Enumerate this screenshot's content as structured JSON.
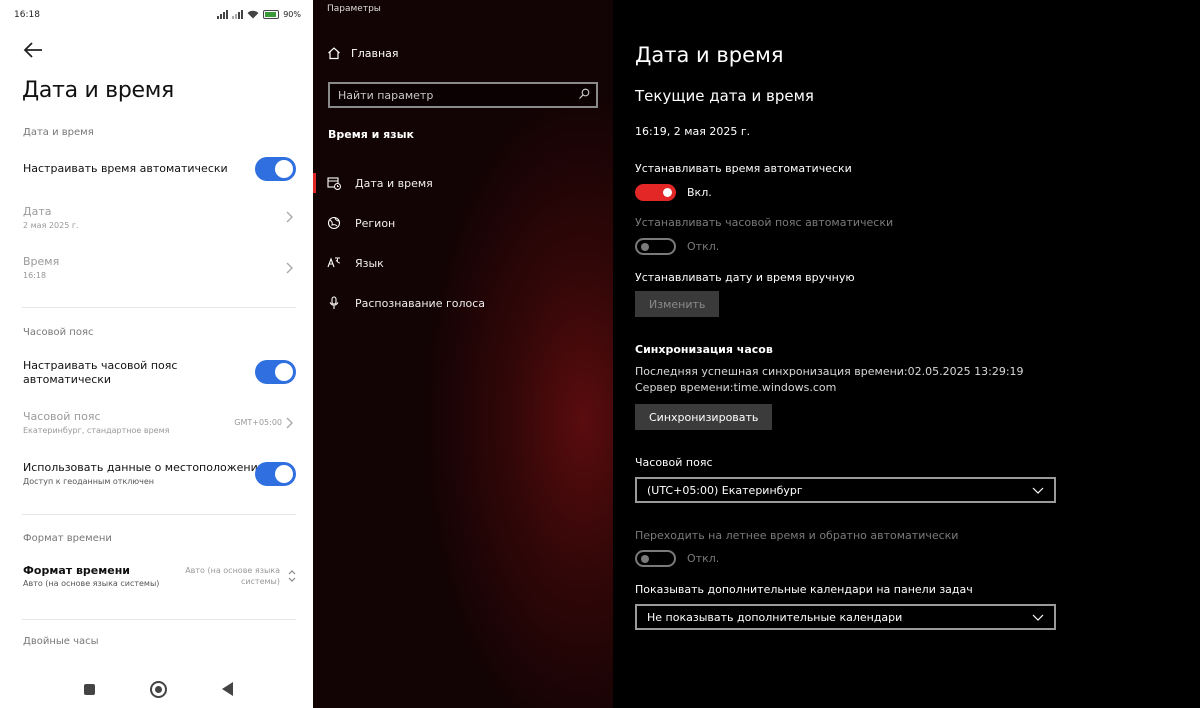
{
  "android": {
    "status": {
      "time": "16:18",
      "battery": "90%"
    },
    "title": "Дата и время",
    "section_datetime": "Дата и время",
    "auto_time_label": "Настраивать время автоматически",
    "date_label": "Дата",
    "date_value": "2 мая 2025 г.",
    "time_label": "Время",
    "time_value": "16:18",
    "section_timezone": "Часовой пояс",
    "auto_tz_line1": "Настраивать часовой пояс",
    "auto_tz_line2": "автоматически",
    "tz_label": "Часовой пояс",
    "tz_value": "Екатеринбург, стандартное время",
    "tz_offset": "GMT+05:00",
    "location_label": "Использовать данные о местоположении",
    "location_sub": "Доступ к геоданным отключен",
    "section_format": "Формат времени",
    "format_label": "Формат времени",
    "format_sub": "Авто (на основе языка системы)",
    "format_right_line1": "Авто (на основе языка",
    "format_right_line2": "системы)",
    "section_dual": "Двойные часы"
  },
  "win_sidebar": {
    "app_title": "Параметры",
    "home": "Главная",
    "search_placeholder": "Найти параметр",
    "group": "Время и язык",
    "items": [
      {
        "label": "Дата и время",
        "icon": "calendar-clock-icon"
      },
      {
        "label": "Регион",
        "icon": "globe-icon"
      },
      {
        "label": "Язык",
        "icon": "language-icon"
      },
      {
        "label": "Распознавание голоса",
        "icon": "microphone-icon"
      }
    ]
  },
  "win_main": {
    "title": "Дата и время",
    "subtitle": "Текущие дата и время",
    "current": "16:19, 2 мая 2025 г.",
    "auto_time_label": "Устанавливать время автоматически",
    "auto_time_state": "Вкл.",
    "auto_tz_label": "Устанавливать часовой пояс автоматически",
    "auto_tz_state": "Откл.",
    "manual_label": "Устанавливать дату и время вручную",
    "change_btn": "Изменить",
    "sync_title": "Синхронизация часов",
    "sync_last": "Последняя успешная синхронизация времени:02.05.2025 13:29:19",
    "sync_server": "Сервер времени:time.windows.com",
    "sync_btn": "Синхронизировать",
    "tz_title": "Часовой пояс",
    "tz_value": "(UTC+05:00) Екатеринбург",
    "dst_label": "Переходить на летнее время и обратно автоматически",
    "dst_state": "Откл.",
    "cal_label": "Показывать дополнительные календари на панели задач",
    "cal_value": "Не показывать дополнительные календари"
  },
  "colors": {
    "android_toggle": "#2f6fe0",
    "win_accent": "#e32626"
  }
}
